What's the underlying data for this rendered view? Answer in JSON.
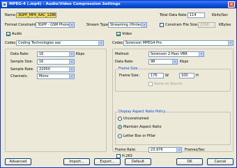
{
  "window": {
    "title": "MPEG-4 (.mp4) - Audio/Video Compression Settings",
    "close_glyph": "×"
  },
  "top": {
    "name_label": "Name:",
    "name_value": "3GPP_MP4_AAC_128K",
    "total_data_rate_label": "Total Data Rate:",
    "total_data_rate_value": "114",
    "total_data_rate_unit": "Kbits/Sec",
    "format_constraints_label": "Format Constraints:",
    "format_constraints_value": "3GPP - GSM Phone",
    "stream_type_label": "Stream Type:",
    "stream_type_value": "Streaming (Hinted)",
    "constrain_file_size_label": "Constrain File Size:",
    "constrain_file_size_value": "2290",
    "constrain_file_size_unit": "KBytes"
  },
  "audio": {
    "enable_label": "Audio",
    "codec_label": "Codec:",
    "codec_value": "Coding Technologies aac",
    "data_rate_label": "Data Rate:",
    "data_rate_value": "16",
    "data_rate_unit": "Kbps",
    "sample_size_label": "Sample Size:",
    "sample_size_value": "16",
    "sample_rate_label": "Sample Rate:",
    "sample_rate_value": "22050",
    "channels_label": "Channels:",
    "channels_value": "Mono"
  },
  "video": {
    "enable_label": "Video",
    "codec_label": "Codec:",
    "codec_value": "Sorenson MPEG4 Pro",
    "method_label": "Method:",
    "method_value": "Sorenson 2-Pass VBR",
    "data_rate_label": "Data Rate:",
    "data_rate_value": "98",
    "data_rate_unit": "Kbps",
    "frame_size_group": "Frame Size",
    "frame_size_label": "Frame Size:",
    "frame_width": "176",
    "width_unit": "W",
    "frame_height": "100",
    "height_unit": "H",
    "same_as_source_label": "Same as Source",
    "aspect_group": "Display Aspect Ratio Policy",
    "aspect_options": [
      "Unconstrained",
      "Maintain Aspect Ratio",
      "Letter Box or Pillar"
    ],
    "frame_rate_label": "Frame Rate:",
    "frame_rate_value": "23.976",
    "frame_rate_unit": "Frames/Sec",
    "h263_label": "H.263"
  },
  "buttons": {
    "advanced": "Advanced",
    "import": "Import...",
    "export": "Export...",
    "default": "Default",
    "ok": "OK",
    "cancel": "Cancel"
  }
}
